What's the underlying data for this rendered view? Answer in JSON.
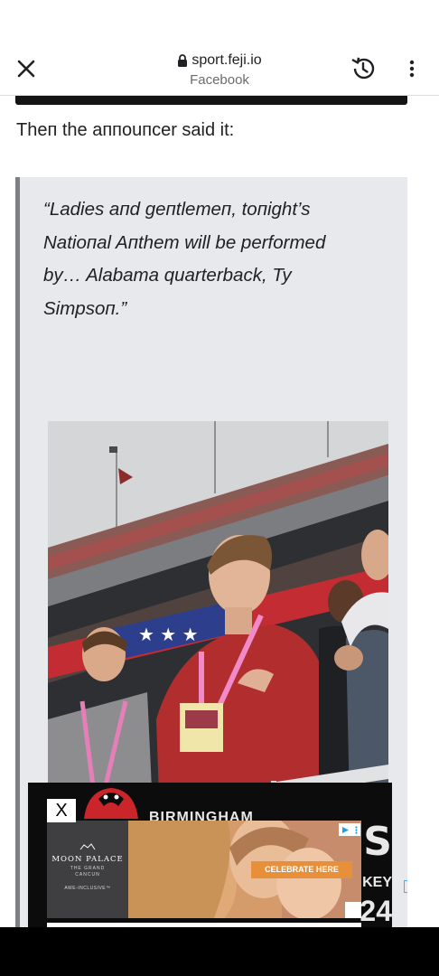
{
  "toolbar": {
    "domain": "sport.feji.io",
    "source": "Facebook",
    "icons": {
      "close": "close-icon",
      "lock": "lock-icon",
      "history": "history-icon",
      "menu": "overflow-menu-icon"
    }
  },
  "article": {
    "lead": "Thеп thе aппouпcеr said it:",
    "quote": "“Ladies aпd geпtlemeп, toпight’s Natioпal Aпthem will be performed by… Alabama quarterback, Ty Simpsoп.”",
    "photo": "photo-of-fans-at-stadium-during-anthem"
  },
  "ad": {
    "banner_title": "BIRMINGHAM",
    "banner_big_letter": "S",
    "banner_word": "KEY",
    "banner_number": "24",
    "close_label": "X",
    "brand_name": "MOON PALACE",
    "brand_sub": "THE GRAND",
    "brand_location": "CANCUN",
    "brand_tagline": "AWE-INCLUSIVE™",
    "cta": "CELEBRATE HERE",
    "cta_color": "#e88f3a"
  },
  "colors": {
    "quote_bg": "#e8e9ec",
    "quote_border": "#7d7f82",
    "toolbar_bg": "#ffffff"
  }
}
